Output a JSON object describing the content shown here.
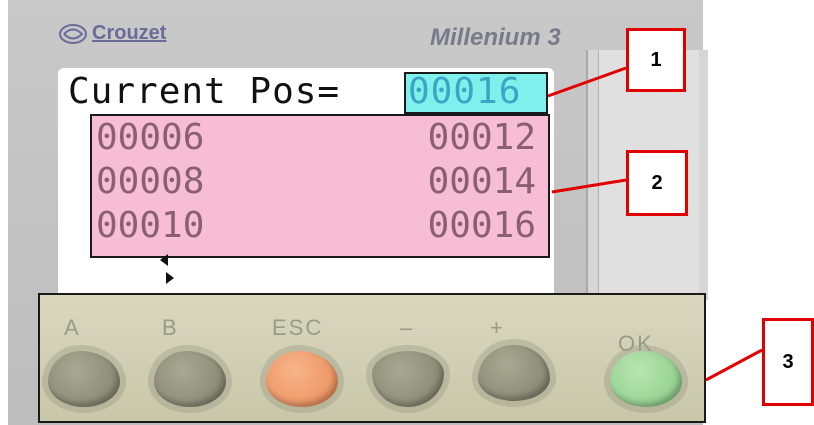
{
  "header": {
    "brand": "Crouzet",
    "model": "Millenium 3"
  },
  "lcd": {
    "title": "Current Pos=",
    "position_value": "00016",
    "rows": [
      {
        "left": "00006",
        "right": "00012"
      },
      {
        "left": "00008",
        "right": "00014"
      },
      {
        "left": "00010",
        "right": "00016"
      }
    ],
    "cursor_icon": "cursor-arrows-icon"
  },
  "keypad": {
    "keys": [
      {
        "label": "A",
        "color": "gray"
      },
      {
        "label": "B",
        "color": "gray"
      },
      {
        "label": "ESC",
        "color": "orange"
      },
      {
        "label": "–",
        "color": "gray"
      },
      {
        "label": "+",
        "color": "gray"
      },
      {
        "label": "OK",
        "color": "green"
      }
    ]
  },
  "callouts": [
    "1",
    "2",
    "3"
  ],
  "colors": {
    "callout_border": "#e00000",
    "position_highlight": "#7ff0ec",
    "list_highlight": "#f6bdd4",
    "keypad_highlight": "#d9d8bf",
    "esc_key": "#e98a55",
    "ok_key": "#86c985"
  }
}
